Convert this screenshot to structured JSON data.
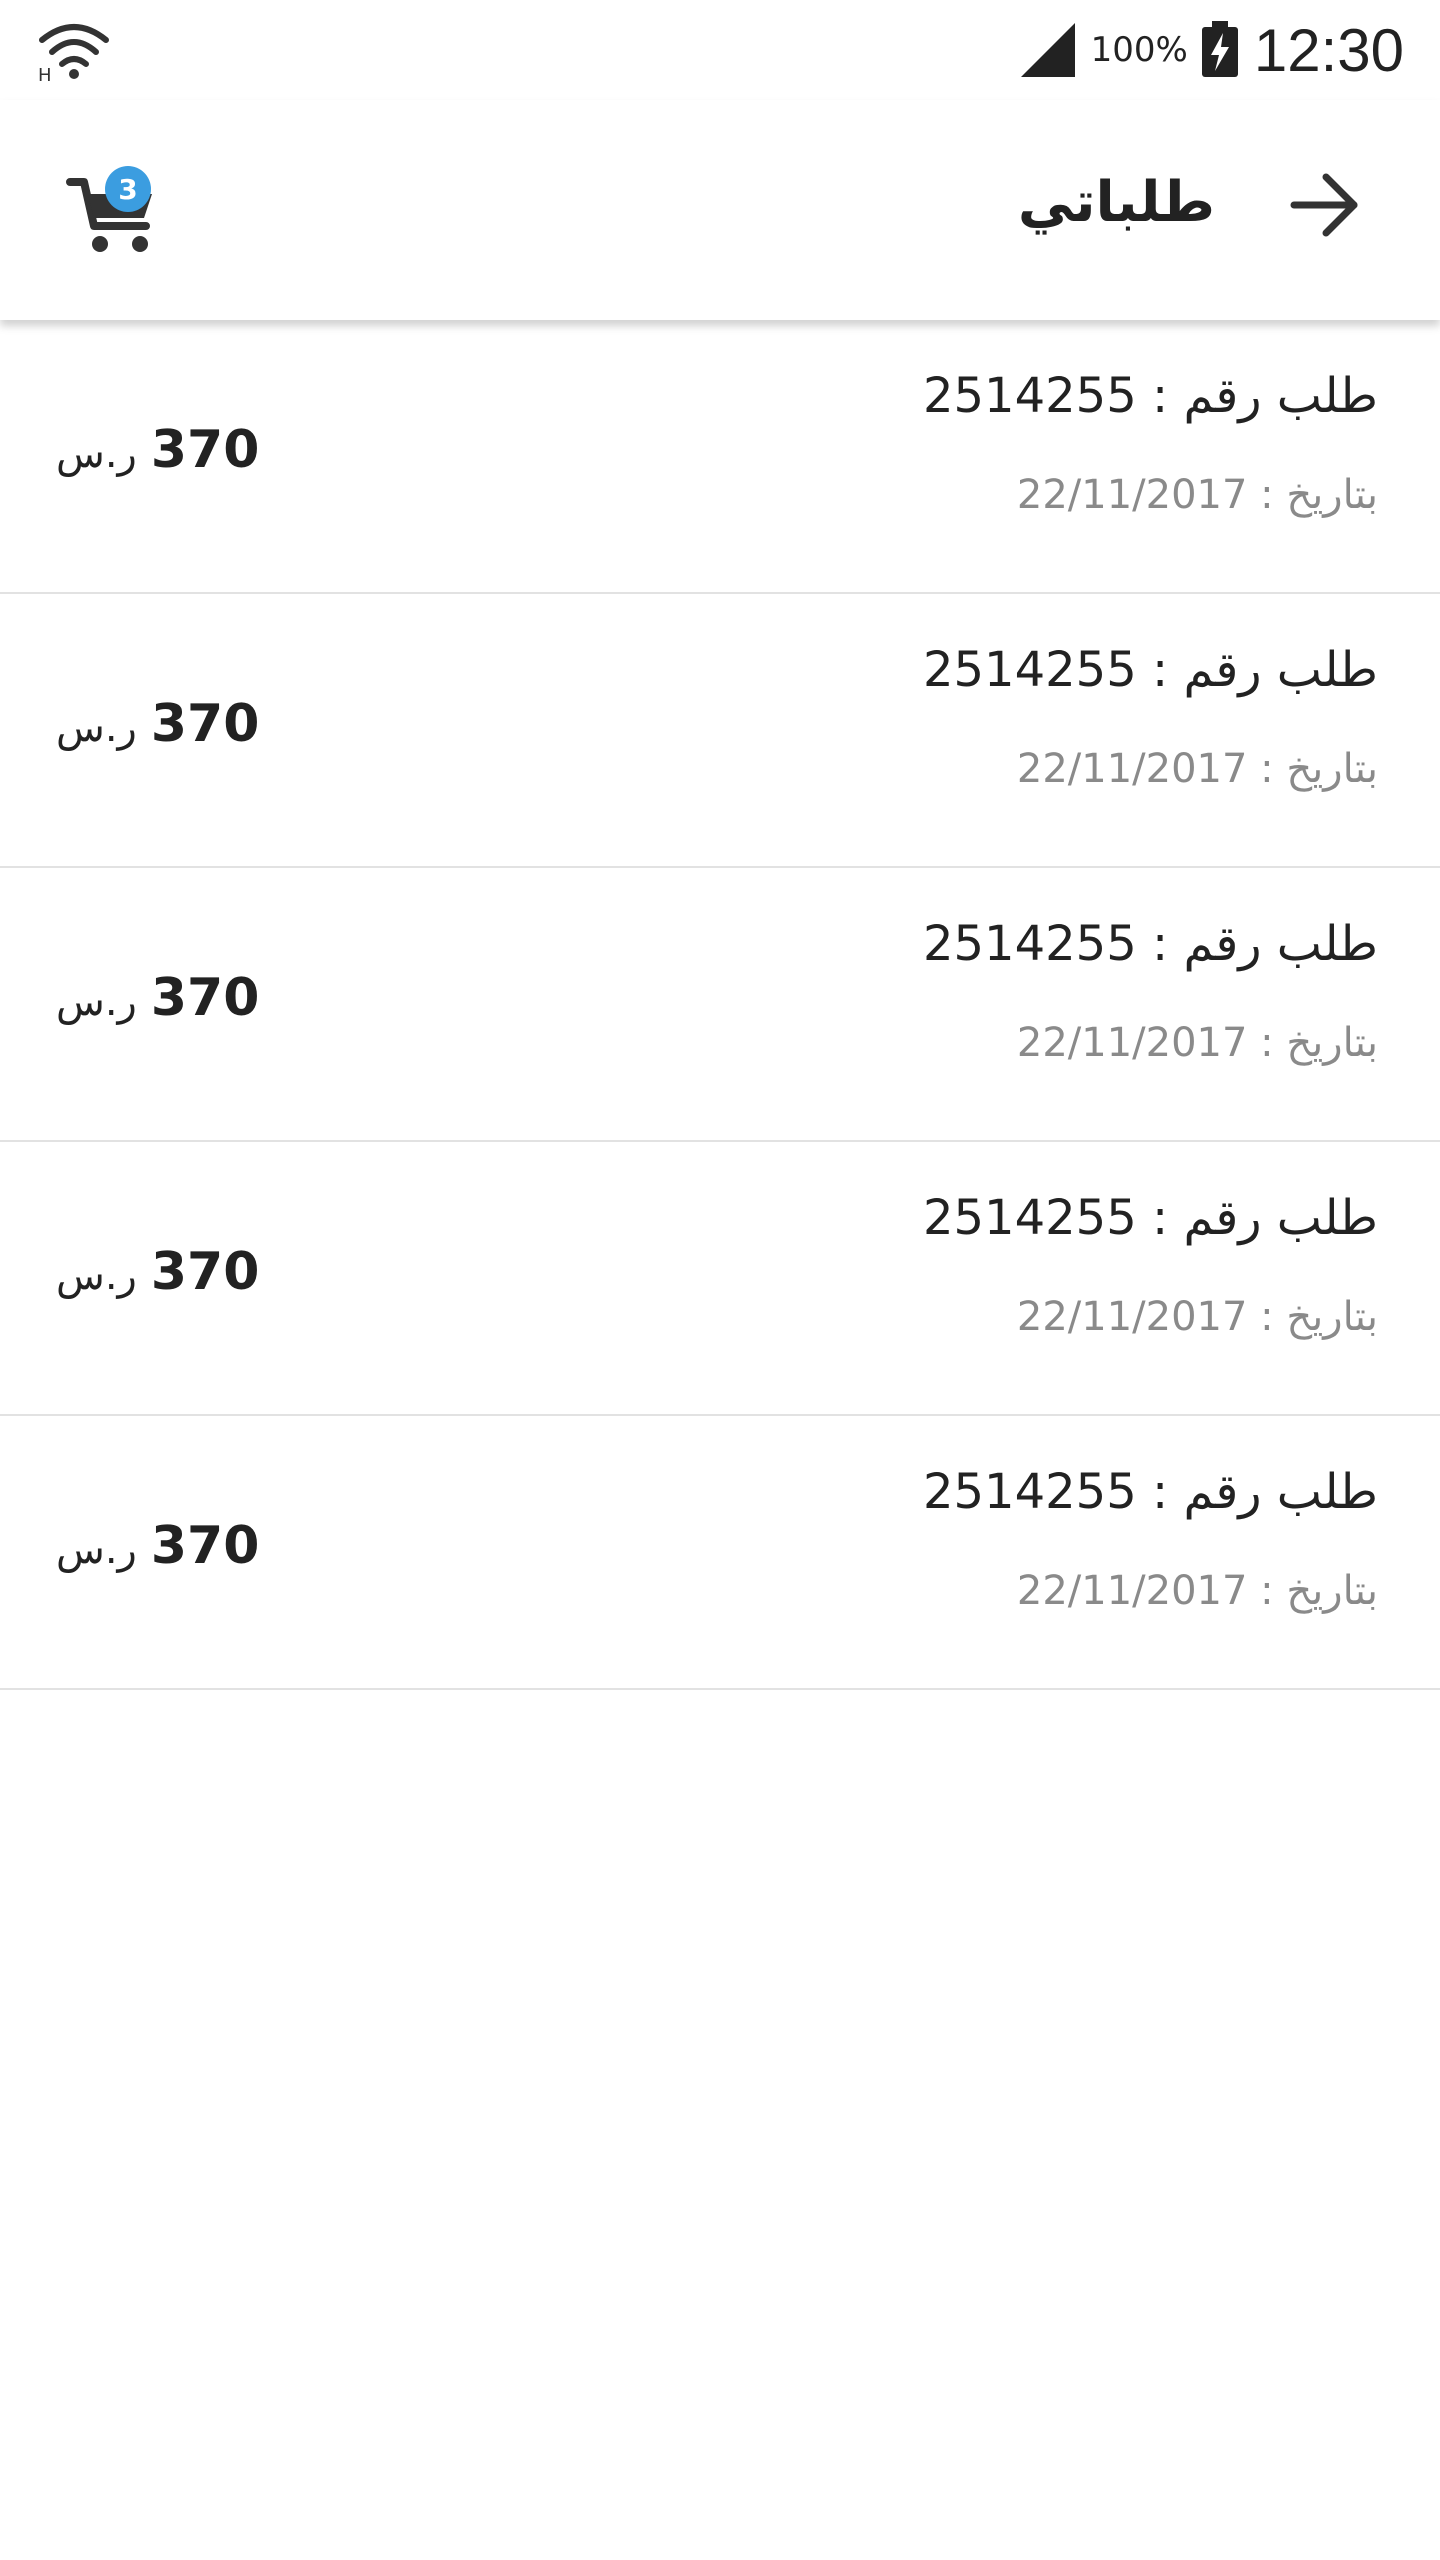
{
  "status_bar": {
    "time": "12:30",
    "battery": "100%",
    "wifi_icon": "wifi-icon",
    "signal_icon": "cell-signal-icon",
    "battery_icon": "battery-charging-icon"
  },
  "header": {
    "title": "طلباتي",
    "back_icon": "arrow-right-icon",
    "cart_icon": "cart-icon",
    "cart_count": "3",
    "badge_color": "#3b9de0"
  },
  "orders": [
    {
      "number": "طلب رقم : 2514255",
      "date": "بتاريخ : 22/11/2017",
      "price": "370",
      "currency": "ر.س"
    },
    {
      "number": "طلب رقم : 2514255",
      "date": "بتاريخ : 22/11/2017",
      "price": "370",
      "currency": "ر.س"
    },
    {
      "number": "طلب رقم : 2514255",
      "date": "بتاريخ : 22/11/2017",
      "price": "370",
      "currency": "ر.س"
    },
    {
      "number": "طلب رقم : 2514255",
      "date": "بتاريخ : 22/11/2017",
      "price": "370",
      "currency": "ر.س"
    },
    {
      "number": "طلب رقم : 2514255",
      "date": "بتاريخ : 22/11/2017",
      "price": "370",
      "currency": "ر.س"
    }
  ]
}
